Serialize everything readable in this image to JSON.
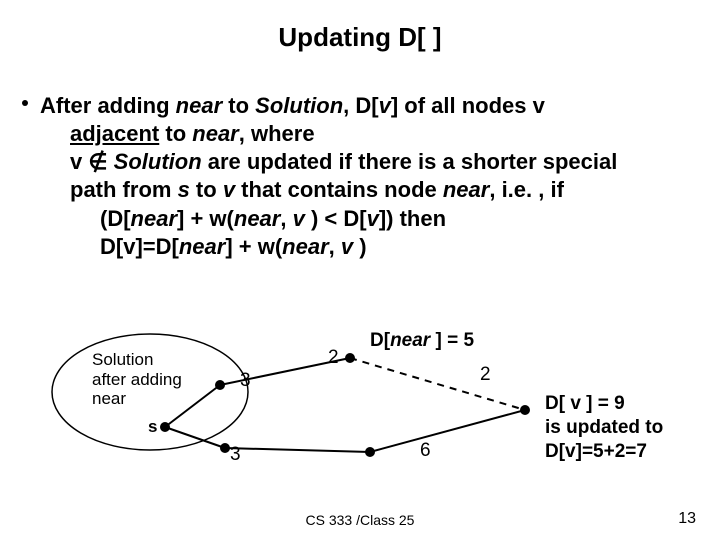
{
  "title": "Updating D[ ]",
  "bullet": {
    "l1a": "After adding ",
    "near": "near",
    "l1b": " to ",
    "solution": "Solution",
    "l1c": ", D[",
    "v": "v",
    "l1d": "] of all nodes v",
    "l2a": "adjacent",
    "l2b": " to ",
    "l2c": ", where",
    "l3a": "v ",
    "notin": "∉",
    "l3b": " are updated if there is a shorter special",
    "l4a": "path from ",
    "s": "s",
    "l4b": " to ",
    "l4c": " that contains node ",
    "l4d": ", i.e. , if",
    "l5a": "(D[",
    "l5b": "] + w(",
    "l5c": ", ",
    "l5d": " ) < D[",
    "l5e": "]) then",
    "l6a": "D[v]=D[",
    "l6b": "] + w(",
    "l6c": ", ",
    "l6d": " )"
  },
  "fig": {
    "set_label_l1": "Solution",
    "set_label_l2": "after adding",
    "set_label_l3": "near",
    "s_label": "s",
    "w_3a": "3",
    "w_3b": "3",
    "w_2a": "2",
    "w_2b": "2",
    "w_6": "6",
    "dnear": "D[near ] = 5",
    "dv_l1": "D[ v ] = 9",
    "dv_l2": "is updated to",
    "dv_l3": "D[v]=5+2=7"
  },
  "footer": "CS 333 /Class  25",
  "page": "13"
}
